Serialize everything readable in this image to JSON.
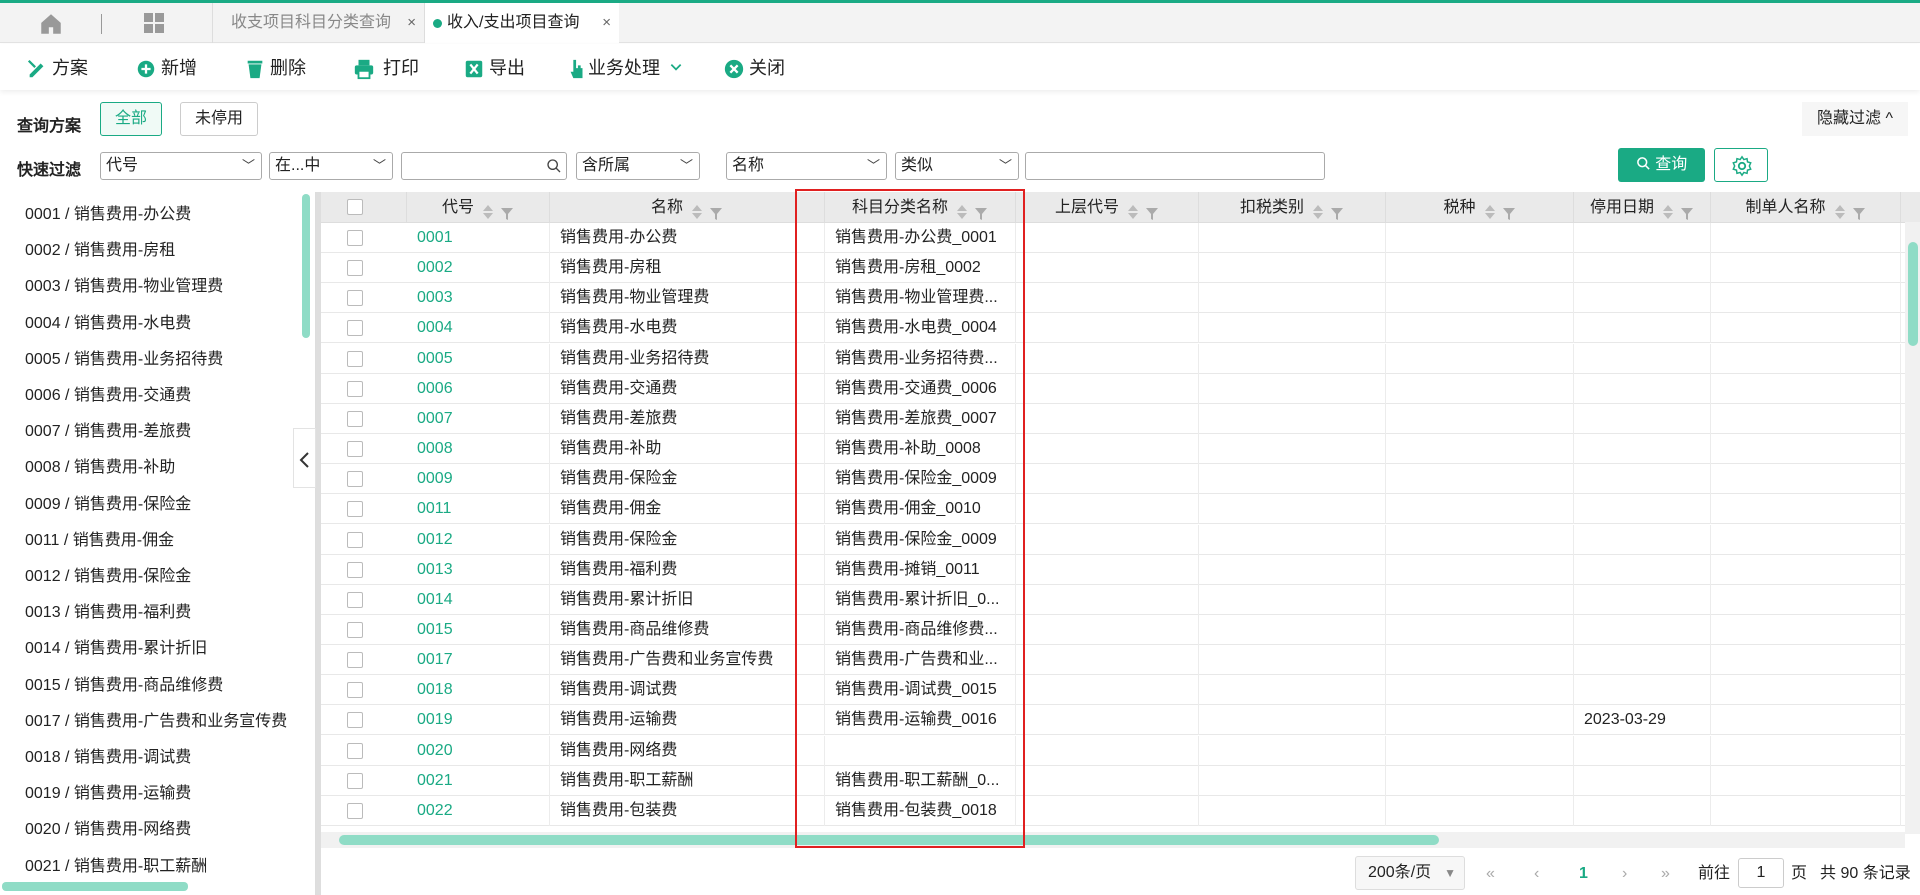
{
  "tabs": {
    "tab1_label": "收支项目科目分类查询",
    "tab2_label": "收入/支出项目查询",
    "close_glyph": "×"
  },
  "toolbar": {
    "plan": "方案",
    "add": "新增",
    "delete": "删除",
    "print": "打印",
    "export": "导出",
    "business": "业务处理",
    "close": "关闭"
  },
  "query": {
    "label": "查询方案",
    "all": "全部",
    "enabled": "未停用",
    "hide_filter": "隐藏过滤 ^"
  },
  "quick": {
    "label": "快速过滤",
    "field1": "代号",
    "op1": "在...中",
    "value1": "",
    "include": "含所属",
    "field2": "名称",
    "op2": "类似",
    "value2": "",
    "search_btn": "查询"
  },
  "tree": {
    "items": [
      "0001 / 销售费用-办公费",
      "0002 / 销售费用-房租",
      "0003 / 销售费用-物业管理费",
      "0004 / 销售费用-水电费",
      "0005 / 销售费用-业务招待费",
      "0006 / 销售费用-交通费",
      "0007 / 销售费用-差旅费",
      "0008 / 销售费用-补助",
      "0009 / 销售费用-保险金",
      "0011 / 销售费用-佣金",
      "0012 / 销售费用-保险金",
      "0013 / 销售费用-福利费",
      "0014 / 销售费用-累计折旧",
      "0015 / 销售费用-商品维修费",
      "0017 / 销售费用-广告费和业务宣传费",
      "0018 / 销售费用-调试费",
      "0019 / 销售费用-运输费",
      "0020 / 销售费用-网络费",
      "0021 / 销售费用-职工薪酬"
    ]
  },
  "table": {
    "columns": [
      "代号",
      "名称",
      "科目分类名称",
      "上层代号",
      "扣税类别",
      "税种",
      "停用日期",
      "制单人名称"
    ],
    "rows": [
      {
        "code": "0001",
        "name": "销售费用-办公费",
        "category": "销售费用-办公费_0001",
        "stop": ""
      },
      {
        "code": "0002",
        "name": "销售费用-房租",
        "category": "销售费用-房租_0002",
        "stop": ""
      },
      {
        "code": "0003",
        "name": "销售费用-物业管理费",
        "category": "销售费用-物业管理费...",
        "stop": ""
      },
      {
        "code": "0004",
        "name": "销售费用-水电费",
        "category": "销售费用-水电费_0004",
        "stop": ""
      },
      {
        "code": "0005",
        "name": "销售费用-业务招待费",
        "category": "销售费用-业务招待费...",
        "stop": ""
      },
      {
        "code": "0006",
        "name": "销售费用-交通费",
        "category": "销售费用-交通费_0006",
        "stop": ""
      },
      {
        "code": "0007",
        "name": "销售费用-差旅费",
        "category": "销售费用-差旅费_0007",
        "stop": ""
      },
      {
        "code": "0008",
        "name": "销售费用-补助",
        "category": "销售费用-补助_0008",
        "stop": ""
      },
      {
        "code": "0009",
        "name": "销售费用-保险金",
        "category": "销售费用-保险金_0009",
        "stop": ""
      },
      {
        "code": "0011",
        "name": "销售费用-佣金",
        "category": "销售费用-佣金_0010",
        "stop": ""
      },
      {
        "code": "0012",
        "name": "销售费用-保险金",
        "category": "销售费用-保险金_0009",
        "stop": ""
      },
      {
        "code": "0013",
        "name": "销售费用-福利费",
        "category": "销售费用-摊销_0011",
        "stop": ""
      },
      {
        "code": "0014",
        "name": "销售费用-累计折旧",
        "category": "销售费用-累计折旧_0...",
        "stop": ""
      },
      {
        "code": "0015",
        "name": "销售费用-商品维修费",
        "category": "销售费用-商品维修费...",
        "stop": ""
      },
      {
        "code": "0017",
        "name": "销售费用-广告费和业务宣传费",
        "category": "销售费用-广告费和业...",
        "stop": ""
      },
      {
        "code": "0018",
        "name": "销售费用-调试费",
        "category": "销售费用-调试费_0015",
        "stop": ""
      },
      {
        "code": "0019",
        "name": "销售费用-运输费",
        "category": "销售费用-运输费_0016",
        "stop": "2023-03-29"
      },
      {
        "code": "0020",
        "name": "销售费用-网络费",
        "category": "",
        "stop": ""
      },
      {
        "code": "0021",
        "name": "销售费用-职工薪酬",
        "category": "销售费用-职工薪酬_0...",
        "stop": ""
      },
      {
        "code": "0022",
        "name": "销售费用-包装费",
        "category": "销售费用-包装费_0018",
        "stop": ""
      }
    ]
  },
  "pager": {
    "page_size": "200条/页",
    "current_page": "1",
    "goto_label": "前往",
    "goto_value": "1",
    "page_suffix": "页",
    "total": "共 90 条记录"
  },
  "colors": {
    "accent": "#1aaa84",
    "highlight": "#e02020"
  }
}
